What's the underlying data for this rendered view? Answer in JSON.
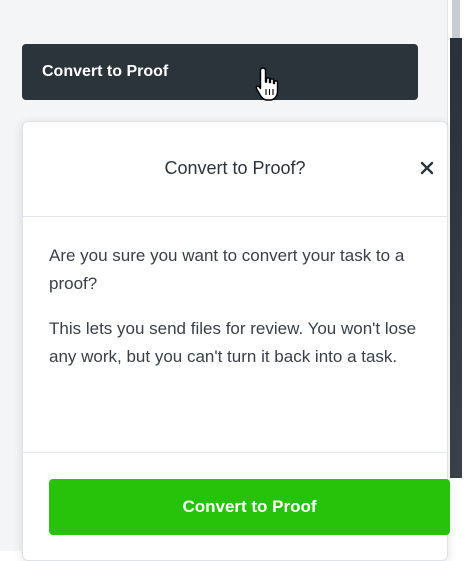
{
  "top_button": {
    "label": "Convert to Proof"
  },
  "dialog": {
    "title": "Convert to Proof?",
    "close_icon": "close-icon",
    "body": {
      "paragraph_1": "Are you sure you want to convert your task to a proof?",
      "paragraph_2": "This lets you send files for review. You won't lose any work, but you can't turn it back into a task."
    },
    "confirm_label": "Convert to Proof"
  },
  "colors": {
    "dark_button": "#2b333b",
    "confirm_green": "#27c20a"
  }
}
